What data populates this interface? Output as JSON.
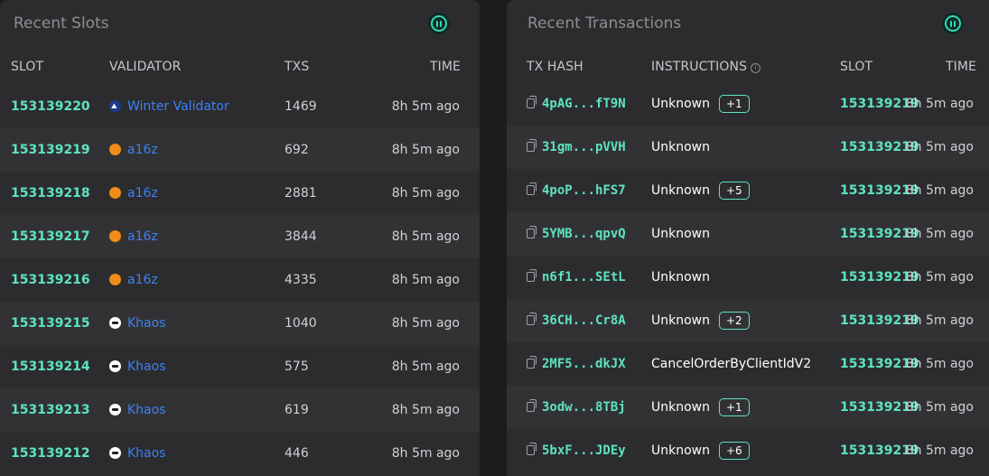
{
  "slots_panel": {
    "title": "Recent Slots",
    "headers": {
      "slot": "SLOT",
      "validator": "VALIDATOR",
      "txs": "TXS",
      "time": "TIME"
    },
    "rows": [
      {
        "slot": "153139220",
        "validator": "Winter Validator",
        "icon": "winter-validator-icon",
        "txs": "1469",
        "time": "8h 5m ago"
      },
      {
        "slot": "153139219",
        "validator": "a16z",
        "icon": "a16z-icon",
        "txs": "692",
        "time": "8h 5m ago"
      },
      {
        "slot": "153139218",
        "validator": "a16z",
        "icon": "a16z-icon",
        "txs": "2881",
        "time": "8h 5m ago"
      },
      {
        "slot": "153139217",
        "validator": "a16z",
        "icon": "a16z-icon",
        "txs": "3844",
        "time": "8h 5m ago"
      },
      {
        "slot": "153139216",
        "validator": "a16z",
        "icon": "a16z-icon",
        "txs": "4335",
        "time": "8h 5m ago"
      },
      {
        "slot": "153139215",
        "validator": "Khaos",
        "icon": "khaos-icon",
        "txs": "1040",
        "time": "8h 5m ago"
      },
      {
        "slot": "153139214",
        "validator": "Khaos",
        "icon": "khaos-icon",
        "txs": "575",
        "time": "8h 5m ago"
      },
      {
        "slot": "153139213",
        "validator": "Khaos",
        "icon": "khaos-icon",
        "txs": "619",
        "time": "8h 5m ago"
      },
      {
        "slot": "153139212",
        "validator": "Khaos",
        "icon": "khaos-icon",
        "txs": "446",
        "time": "8h 5m ago"
      }
    ]
  },
  "tx_panel": {
    "title": "Recent Transactions",
    "headers": {
      "hash": "TX HASH",
      "instructions": "INSTRUCTIONS",
      "slot": "SLOT",
      "time": "TIME"
    },
    "rows": [
      {
        "hash": "4pAG...fT9N",
        "instruction": "Unknown",
        "extra": "+1",
        "slot": "153139219",
        "time": "8h 5m ago"
      },
      {
        "hash": "31gm...pVVH",
        "instruction": "Unknown",
        "extra": "",
        "slot": "153139219",
        "time": "8h 5m ago"
      },
      {
        "hash": "4poP...hFS7",
        "instruction": "Unknown",
        "extra": "+5",
        "slot": "153139219",
        "time": "8h 5m ago"
      },
      {
        "hash": "5YMB...qpvQ",
        "instruction": "Unknown",
        "extra": "",
        "slot": "153139219",
        "time": "8h 5m ago"
      },
      {
        "hash": "n6f1...SEtL",
        "instruction": "Unknown",
        "extra": "",
        "slot": "153139219",
        "time": "8h 5m ago"
      },
      {
        "hash": "36CH...Cr8A",
        "instruction": "Unknown",
        "extra": "+2",
        "slot": "153139219",
        "time": "8h 5m ago"
      },
      {
        "hash": "2MF5...dkJX",
        "instruction": "CancelOrderByClientIdV2",
        "extra": "",
        "slot": "153139219",
        "time": "8h 5m ago"
      },
      {
        "hash": "3odw...8TBj",
        "instruction": "Unknown",
        "extra": "+1",
        "slot": "153139219",
        "time": "8h 5m ago"
      },
      {
        "hash": "5bxF...JDEy",
        "instruction": "Unknown",
        "extra": "+6",
        "slot": "153139219",
        "time": "8h 5m ago"
      }
    ]
  },
  "colors": {
    "accent": "#5ee3c1",
    "link": "#3b82f6",
    "panel": "#2c2c2e"
  }
}
